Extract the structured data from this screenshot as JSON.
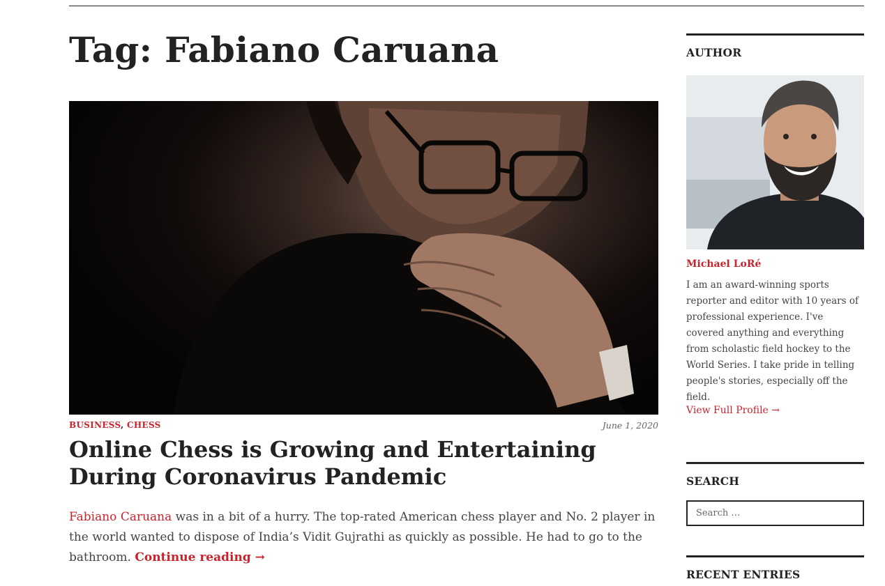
{
  "archive": {
    "title": "Tag: Fabiano Caruana"
  },
  "post": {
    "categories": [
      "Business",
      "Chess"
    ],
    "category_separator": ", ",
    "date": "June 1, 2020",
    "title": "Online Chess is Growing and Entertaining During Coronavirus Pandemic",
    "excerpt_link": "Fabiano Caruana",
    "excerpt_text": " was in a bit of a hurry. The top-rated American chess player and No. 2 player in the world wanted to dispose of India’s Vidit Gujrathi as quickly as possible. He had to go to the bathroom. ",
    "continue_label": "Continue reading →"
  },
  "sidebar": {
    "author": {
      "heading": "Author",
      "name": "Michael LoRé",
      "bio": "I am an award-winning sports reporter and editor with 10 years of professional experience. I've covered anything and everything from scholastic field hockey to the World Series. I take pride in telling people's stories, especially off the field.",
      "profile_link": "View Full Profile →"
    },
    "search": {
      "heading": "Search",
      "placeholder": "Search …"
    },
    "recent": {
      "heading": "Recent Entries"
    }
  },
  "colors": {
    "accent": "#c8232c",
    "text": "#222222",
    "muted": "#444444"
  }
}
